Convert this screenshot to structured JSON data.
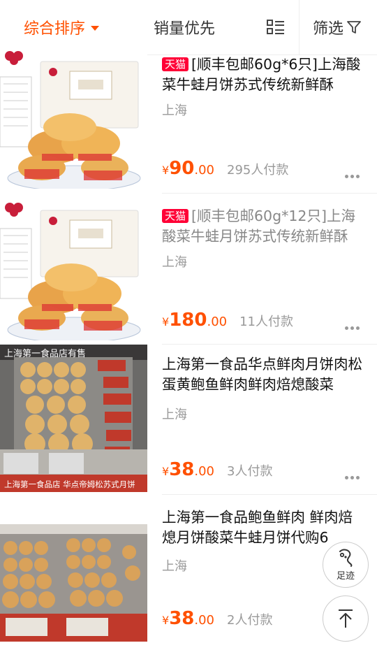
{
  "toolbar": {
    "sort_label": "综合排序",
    "sales_label": "销量优先",
    "filter_label": "筛选"
  },
  "products": [
    {
      "badge": "天猫",
      "title": "[顺丰包邮60g*6只]上海酸菜牛蛙月饼苏式传统新鲜酥",
      "location": "上海",
      "price_symbol": "¥",
      "price_int": "90",
      "price_dec": ".00",
      "buyers": "295人付款"
    },
    {
      "badge": "天猫",
      "title": "[顺丰包邮60g*12只]上海酸菜牛蛙月饼苏式传统新鲜酥",
      "location": "上海",
      "price_symbol": "¥",
      "price_int": "180",
      "price_dec": ".00",
      "buyers": "11人付款"
    },
    {
      "badge": "",
      "title": "上海第一食品华点鲜肉月饼肉松蛋黄鲍鱼鲜肉鲜肉焙熄酸菜",
      "location": "上海",
      "price_symbol": "¥",
      "price_int": "38",
      "price_dec": ".00",
      "buyers": "3人付款",
      "image_texts": {
        "top": "上海第一食品店有售",
        "bottom": "上海第一食品店 华点帝姆松苏式月饼"
      }
    },
    {
      "badge": "",
      "title": "上海第一食品鲍鱼鲜肉 鲜肉焙熄月饼酸菜牛蛙月饼代购6",
      "location": "上海",
      "price_symbol": "¥",
      "price_int": "38",
      "price_dec": ".00",
      "buyers": "2人付款"
    }
  ],
  "floating": {
    "footprint_label": "足迹"
  },
  "colors": {
    "accent": "#ff5000",
    "tmall": "#ff0036"
  }
}
